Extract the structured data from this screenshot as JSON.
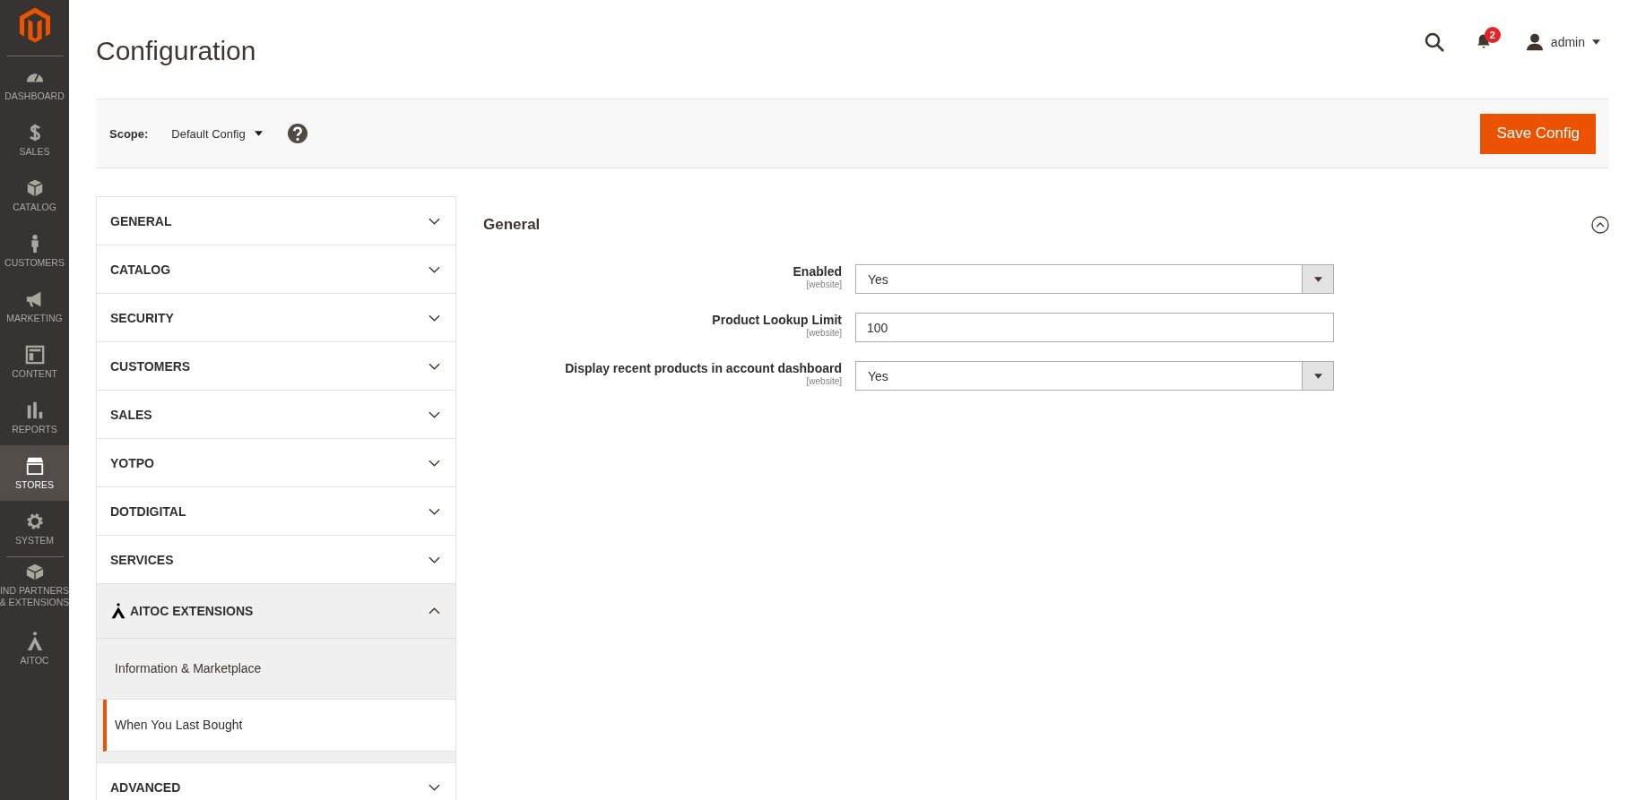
{
  "sidebar": {
    "items": [
      {
        "label": "DASHBOARD",
        "kind": "dashboard",
        "selected": false
      },
      {
        "label": "SALES",
        "kind": "sales",
        "selected": false
      },
      {
        "label": "CATALOG",
        "kind": "catalog",
        "selected": false
      },
      {
        "label": "CUSTOMERS",
        "kind": "customers",
        "selected": false
      },
      {
        "label": "MARKETING",
        "kind": "marketing",
        "selected": false
      },
      {
        "label": "CONTENT",
        "kind": "content",
        "selected": false
      },
      {
        "label": "REPORTS",
        "kind": "reports",
        "selected": false
      },
      {
        "label": "STORES",
        "kind": "stores",
        "selected": true
      },
      {
        "label": "SYSTEM",
        "kind": "system",
        "selected": false
      },
      {
        "label": "IND PARTNERS\n& EXTENSIONS",
        "kind": "partners",
        "selected": false
      },
      {
        "label": "AITOC",
        "kind": "aitoc",
        "selected": false
      }
    ]
  },
  "header": {
    "title": "Configuration",
    "notification_count": "2",
    "user": "admin"
  },
  "scope_bar": {
    "label": "Scope:",
    "value": "Default Config",
    "save_button": "Save Config"
  },
  "config_nav": [
    {
      "label": "GENERAL",
      "expanded": false
    },
    {
      "label": "CATALOG",
      "expanded": false
    },
    {
      "label": "SECURITY",
      "expanded": false
    },
    {
      "label": "CUSTOMERS",
      "expanded": false
    },
    {
      "label": "SALES",
      "expanded": false
    },
    {
      "label": "YOTPO",
      "expanded": false
    },
    {
      "label": "DOTDIGITAL",
      "expanded": false
    },
    {
      "label": "SERVICES",
      "expanded": false
    },
    {
      "label": "AITOC EXTENSIONS",
      "expanded": true,
      "logo": true,
      "children": [
        {
          "label": "Information & Marketplace",
          "selected": false
        },
        {
          "label": "When You Last Bought",
          "selected": true
        }
      ]
    },
    {
      "label": "ADVANCED",
      "expanded": false
    }
  ],
  "section": {
    "title": "General",
    "expanded": true,
    "fields": [
      {
        "label": "Enabled",
        "scope": "[website]",
        "kind": "select",
        "value": "Yes"
      },
      {
        "label": "Product Lookup Limit",
        "scope": "[website]",
        "kind": "text",
        "value": "100"
      },
      {
        "label": "Display recent products in account dashboard",
        "scope": "[website]",
        "kind": "select",
        "value": "Yes"
      }
    ]
  }
}
